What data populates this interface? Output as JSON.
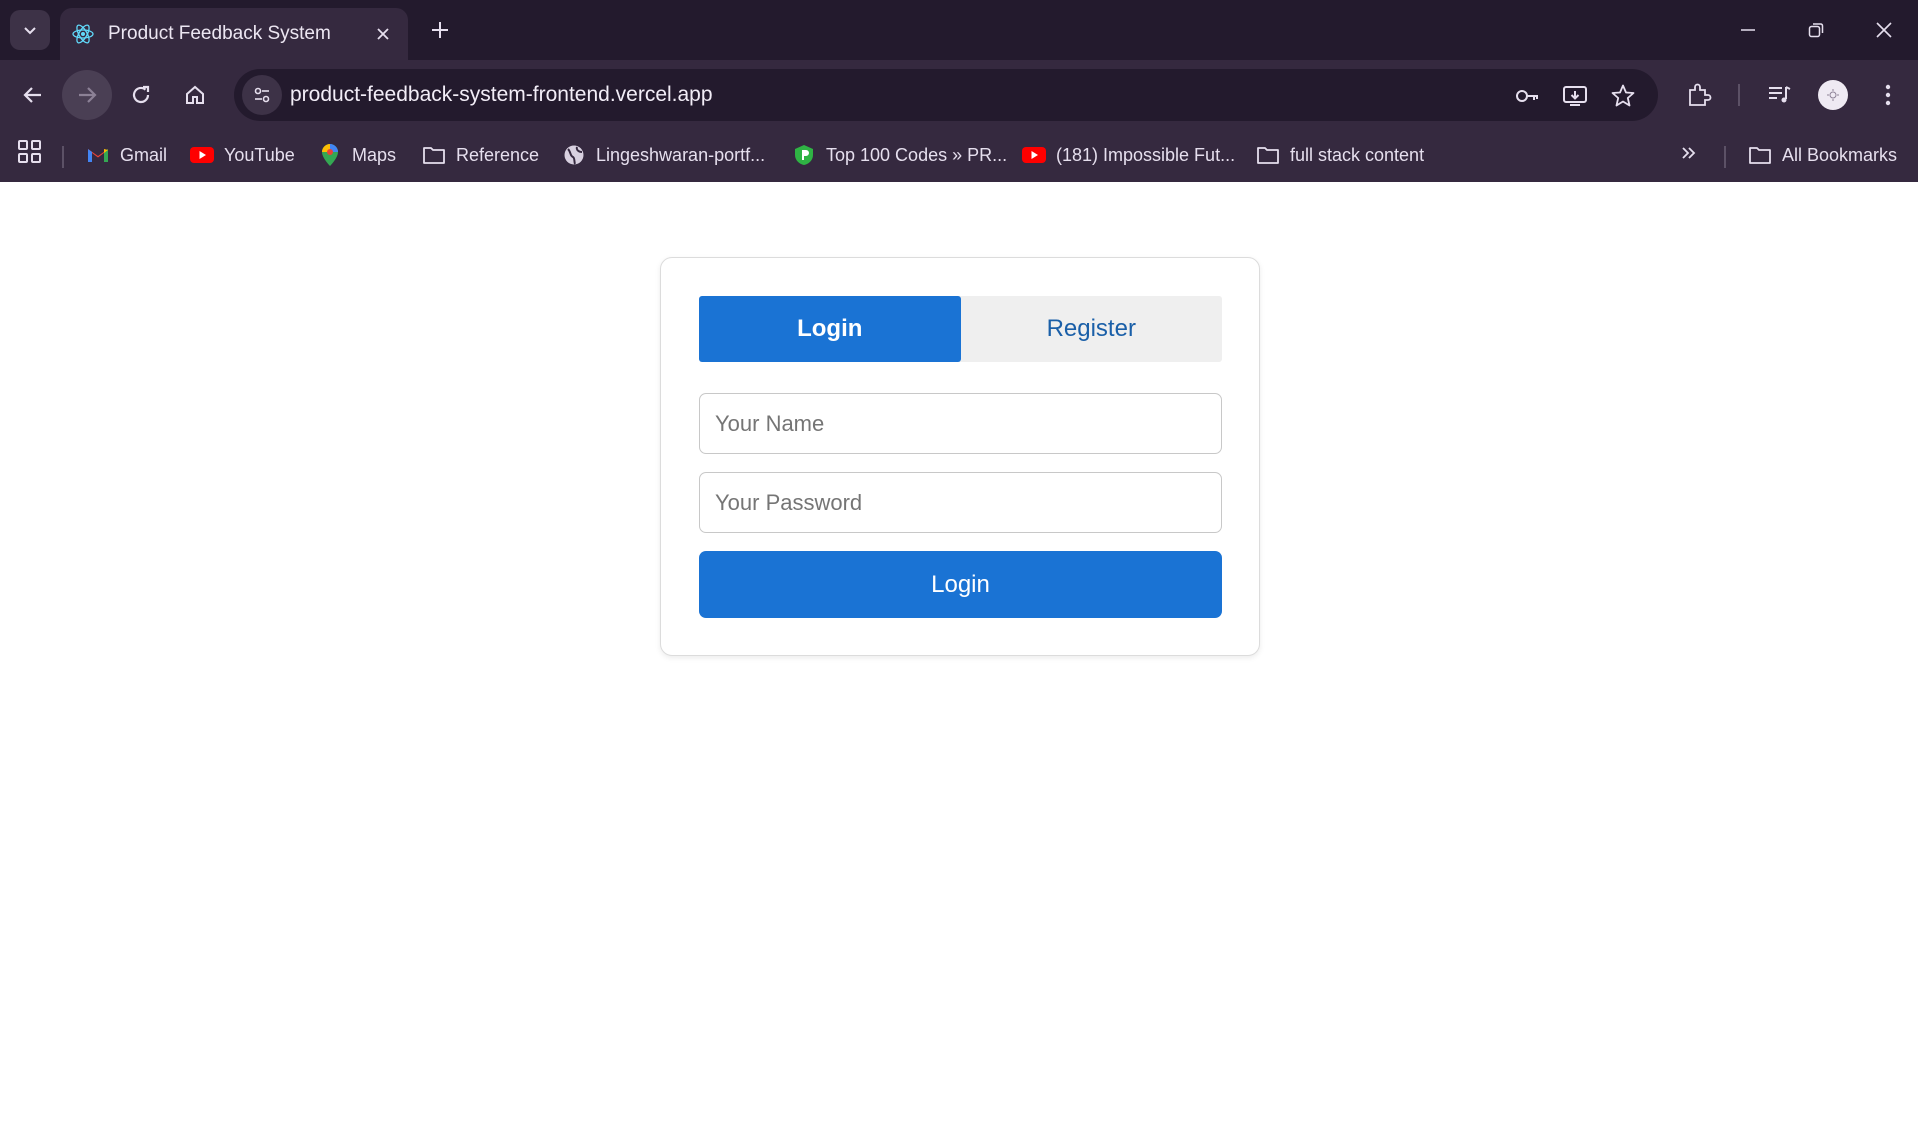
{
  "browser": {
    "tab_title": "Product Feedback System",
    "url": "product-feedback-system-frontend.vercel.app",
    "bookmarks": [
      {
        "label": "Gmail",
        "icon": "gmail-icon"
      },
      {
        "label": "YouTube",
        "icon": "youtube-icon"
      },
      {
        "label": "Maps",
        "icon": "maps-icon"
      },
      {
        "label": "Reference",
        "icon": "folder-icon"
      },
      {
        "label": "Lingeshwaran-portf...",
        "icon": "globe-icon"
      },
      {
        "label": "Top 100 Codes » PR...",
        "icon": "shield-icon"
      },
      {
        "label": "(181) Impossible Fut...",
        "icon": "youtube-icon"
      },
      {
        "label": "full stack content",
        "icon": "folder-icon"
      }
    ],
    "all_bookmarks_label": "All Bookmarks"
  },
  "auth": {
    "tabs": {
      "login": "Login",
      "register": "Register"
    },
    "active_tab": "login",
    "name_placeholder": "Your Name",
    "password_placeholder": "Your Password",
    "submit_label": "Login"
  },
  "colors": {
    "accent": "#1a73d4",
    "browser_frame": "#35293f",
    "tabstrip": "#231a2d"
  }
}
